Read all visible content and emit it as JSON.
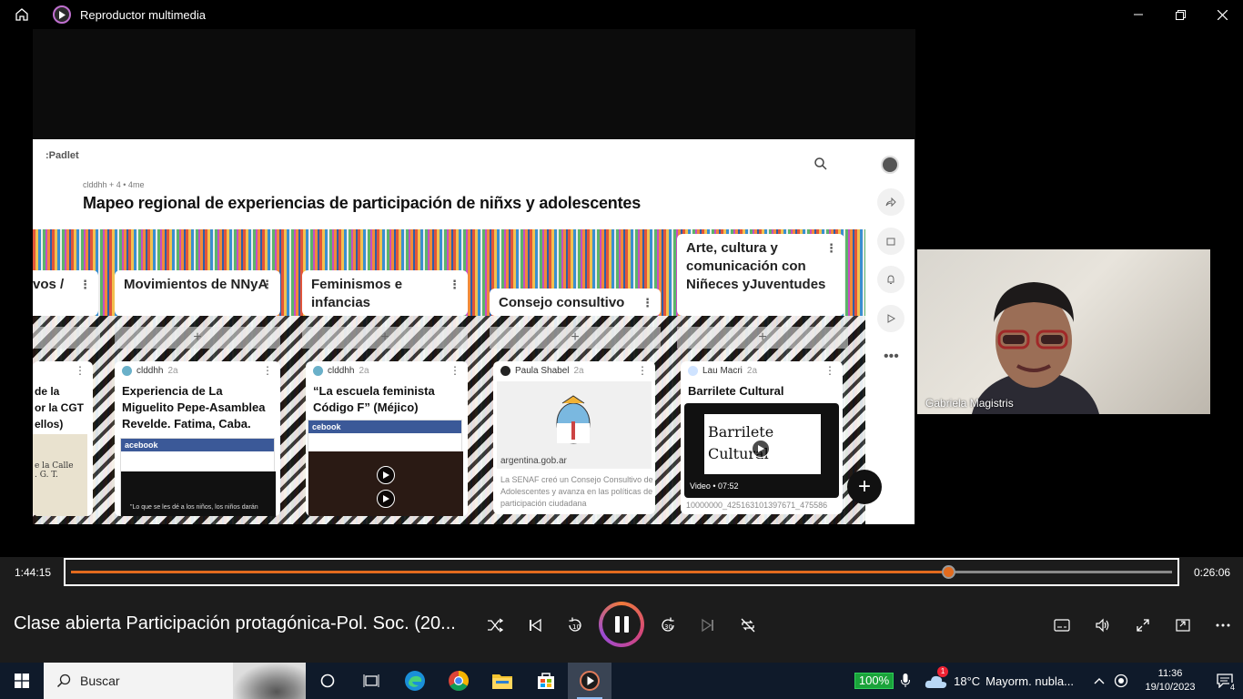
{
  "window": {
    "title": "Reproductor multimedia"
  },
  "padlet": {
    "logo": ":Padlet",
    "meta": "clddhh + 4 •  4me",
    "heading": "Mapeo regional de experiencias de participación de niñxs y adolescentes",
    "columns": [
      {
        "title": "vos /",
        "id": "partial"
      },
      {
        "title": "Movimientos de NNyA",
        "id": "movimientos"
      },
      {
        "title": "Feminismos e infancias",
        "id": "feminismos"
      },
      {
        "title": "Consejo consultivo",
        "id": "consejo"
      },
      {
        "title": "Arte, cultura y comunicación con Niñeces yJuventudes",
        "id": "arte"
      }
    ],
    "posts": [
      {
        "title": "de la\nor la CGT\nellos)",
        "thumb_text": "e la Calle\n. G. T."
      },
      {
        "author": "clddhh",
        "age": "2a",
        "title": "Experiencia de La Miguelito Pepe-Asamblea Revelde. Fatima, Caba.",
        "thumb_brand": "acebook",
        "thumb_caption": "\"Lo que se les dé a los niños, los niños darán"
      },
      {
        "author": "clddhh",
        "age": "2a",
        "title": "“La escuela feminista Código F” (Méjico)",
        "thumb_brand": "cebook"
      },
      {
        "author": "Paula Shabel",
        "age": "2a",
        "link": "argentina.gob.ar",
        "body": "La SENAF creó un Consejo Consultivo de Adolescentes y avanza en las políticas de participación ciudadana"
      },
      {
        "author": "Lau Macri",
        "age": "2a",
        "title": "Barrilete Cultural",
        "thumb_text": "Barrilete Cultural",
        "video_label": "Video • 07:52",
        "file": "10000000_425163101397671_475586"
      }
    ]
  },
  "webcam": {
    "name": "Gabriela Magistris"
  },
  "player": {
    "elapsed": "1:44:15",
    "remaining": "0:26:06",
    "progress": 0.797,
    "media_title": "Clase abierta Participación protagónica-Pol. Soc. (20..."
  },
  "taskbar": {
    "search_label": "Buscar",
    "battery": "100%",
    "weather_temp": "18°C",
    "weather_text": "Mayorm. nubla...",
    "time": "11:36",
    "date": "19/10/2023",
    "notifications": "4",
    "weather_badge": "1"
  }
}
